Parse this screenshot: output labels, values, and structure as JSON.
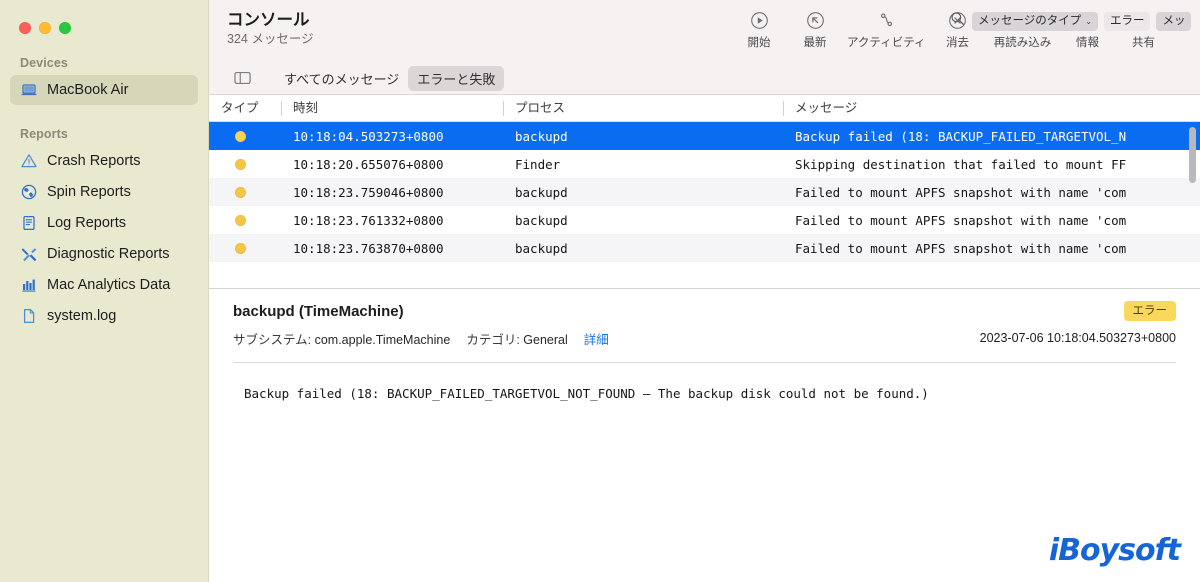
{
  "window": {
    "traffic_lights": [
      "close",
      "minimize",
      "zoom"
    ]
  },
  "sidebar": {
    "sections": [
      {
        "title": "Devices",
        "items": [
          {
            "label": "MacBook Air",
            "icon": "laptop-icon",
            "selected": true
          }
        ]
      },
      {
        "title": "Reports",
        "items": [
          {
            "label": "Crash Reports",
            "icon": "warning-triangle-icon",
            "selected": false
          },
          {
            "label": "Spin Reports",
            "icon": "spinner-icon",
            "selected": false
          },
          {
            "label": "Log Reports",
            "icon": "document-lines-icon",
            "selected": false
          },
          {
            "label": "Diagnostic Reports",
            "icon": "tools-icon",
            "selected": false
          },
          {
            "label": "Mac Analytics Data",
            "icon": "bar-chart-icon",
            "selected": false
          },
          {
            "label": "system.log",
            "icon": "file-icon",
            "selected": false
          }
        ]
      }
    ]
  },
  "toolbar": {
    "title": "コンソール",
    "subtitle": "324 メッセージ",
    "buttons": [
      {
        "label": "開始",
        "icon": "play-circle-icon"
      },
      {
        "label": "最新",
        "icon": "arrow-up-left-circle-icon"
      },
      {
        "label": "アクティビティ",
        "icon": "activity-path-icon"
      },
      {
        "label": "消去",
        "icon": "x-circle-icon"
      },
      {
        "label": "再読み込み",
        "icon": "refresh-icon"
      },
      {
        "label": "情報",
        "icon": "info-circle-filled-icon"
      },
      {
        "label": "共有",
        "icon": "share-icon"
      }
    ],
    "search": {
      "icon": "search-icon",
      "tokens": [
        {
          "label": "メッセージのタイプ",
          "caret": "⌄",
          "type": "dropdown"
        },
        {
          "label": "エラー",
          "type": "plain"
        },
        {
          "label": "メッ",
          "type": "dropdown"
        }
      ]
    }
  },
  "filterbar": {
    "toggle_icon": "sidebar-toggle-icon",
    "tabs": [
      {
        "label": "すべてのメッセージ",
        "active": false
      },
      {
        "label": "エラーと失敗",
        "active": true
      }
    ]
  },
  "table": {
    "columns": [
      "タイプ",
      "時刻",
      "プロセス",
      "メッセージ"
    ],
    "rows": [
      {
        "type_dot": "#f5c544",
        "time": "10:18:04.503273+0800",
        "process": "backupd",
        "message": "Backup failed (18: BACKUP_FAILED_TARGETVOL_N",
        "selected": true
      },
      {
        "type_dot": "#f5c544",
        "time": "10:18:20.655076+0800",
        "process": "Finder",
        "message": "Skipping destination that failed to mount FF",
        "selected": false
      },
      {
        "type_dot": "#f5c544",
        "time": "10:18:23.759046+0800",
        "process": "backupd",
        "message": "Failed to mount APFS snapshot with name 'com",
        "selected": false
      },
      {
        "type_dot": "#f5c544",
        "time": "10:18:23.761332+0800",
        "process": "backupd",
        "message": "Failed to mount APFS snapshot with name 'com",
        "selected": false
      },
      {
        "type_dot": "#f5c544",
        "time": "10:18:23.763870+0800",
        "process": "backupd",
        "message": "Failed to mount APFS snapshot with name 'com",
        "selected": false
      }
    ]
  },
  "detail": {
    "title": "backupd (TimeMachine)",
    "subsystem_label": "サブシステム:",
    "subsystem_value": "com.apple.TimeMachine",
    "category_label": "カテゴリ:",
    "category_value": "General",
    "details_link": "詳細",
    "badge": "エラー",
    "badge_color": "#fbd85d",
    "timestamp": "2023-07-06 10:18:04.503273+0800",
    "body": "Backup failed (18: BACKUP_FAILED_TARGETVOL_NOT_FOUND – The backup disk could not be found.)"
  },
  "watermark": {
    "text": "iBoysoft",
    "color": "#1565d8"
  },
  "colors": {
    "sidebar_bg": "#e9e9cf",
    "selection_blue": "#0a6cf0",
    "toolbar_bg": "#f7f2f2",
    "warning_yellow": "#f5c544"
  }
}
